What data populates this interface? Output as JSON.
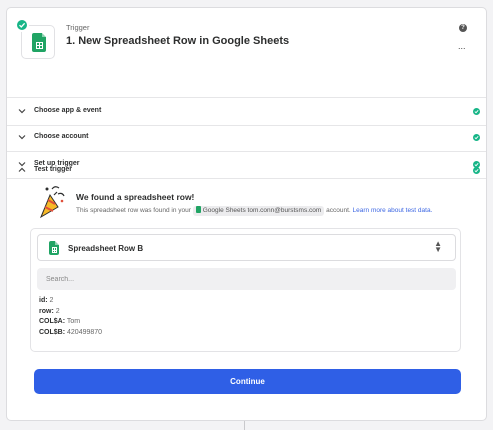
{
  "header": {
    "kind": "Trigger",
    "title": "1. New Spreadsheet Row in Google Sheets",
    "help_icon": "?",
    "more_icon": "..."
  },
  "sections": [
    {
      "label": "Choose app & event",
      "state": "collapsed",
      "complete": true
    },
    {
      "label": "Choose account",
      "state": "collapsed",
      "complete": true
    },
    {
      "label": "Set up trigger",
      "state": "collapsed",
      "complete": true
    },
    {
      "label": "Test trigger",
      "state": "expanded",
      "complete": true
    }
  ],
  "test": {
    "title": "We found a spreadsheet row!",
    "desc_before": "This spreadsheet row was found in your",
    "chip": "Google Sheets tom.conn@burstsms.com",
    "desc_after": "account.",
    "learn_more": "Learn more about test data."
  },
  "sample": {
    "selected": "Spreadsheet Row B",
    "search_placeholder": "Search...",
    "fields": [
      {
        "key": "id:",
        "value": "2"
      },
      {
        "key": "row:",
        "value": "2"
      },
      {
        "key": "COL$A:",
        "value": "Tom"
      },
      {
        "key": "COL$B:",
        "value": "420499870"
      }
    ]
  },
  "continue_label": "Continue",
  "colors": {
    "accent": "#2f5fe6",
    "success": "#17b587",
    "sheets_green": "#20a464"
  },
  "icons": {
    "app": "google-sheets-icon",
    "success": "check-circle-icon",
    "collapsed": "chevron-down-icon",
    "expanded": "chevron-up-icon",
    "celebration": "party-popper-icon"
  }
}
